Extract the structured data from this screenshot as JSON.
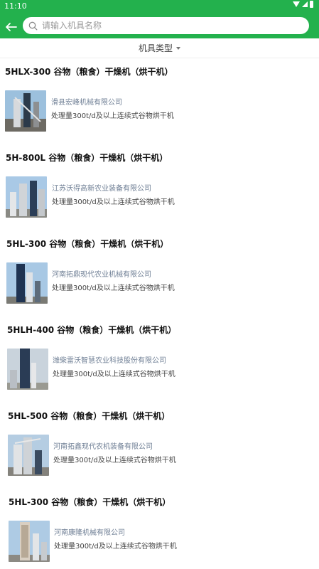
{
  "status": {
    "time": "11:10"
  },
  "search": {
    "placeholder": "请输入机具名称"
  },
  "filter": {
    "label": "机具类型"
  },
  "colors": {
    "accent": "#23b14d",
    "company_text": "#6f7f95"
  },
  "items": [
    {
      "title": "5HLX-300 谷物（粮食）干燥机（烘干机）",
      "company": "滑县宏峰机械有限公司",
      "desc": "处理量300t/d及以上连续式谷物烘干机"
    },
    {
      "title": "5H-800L 谷物（粮食）干燥机（烘干机）",
      "company": "江苏沃得高新农业装备有限公司",
      "desc": "处理量300t/d及以上连续式谷物烘干机"
    },
    {
      "title": "5HL-300 谷物（粮食）干燥机（烘干机）",
      "company": "河南拓鼎现代农业机械有限公司",
      "desc": "处理量300t/d及以上连续式谷物烘干机"
    },
    {
      "title": "5HLH-400 谷物（粮食）干燥机（烘干机）",
      "company": "潍柴雷沃智慧农业科技股份有限公司",
      "desc": "处理量300t/d及以上连续式谷物烘干机"
    },
    {
      "title": "5HL-500 谷物（粮食）干燥机（烘干机）",
      "company": "河南拓鑫现代农机装备有限公司",
      "desc": "处理量300t/d及以上连续式谷物烘干机"
    },
    {
      "title": "5HL-300 谷物（粮食）干燥机（烘干机）",
      "company": "河南康隆机械有限公司",
      "desc": "处理量300t/d及以上连续式谷物烘干机"
    }
  ]
}
